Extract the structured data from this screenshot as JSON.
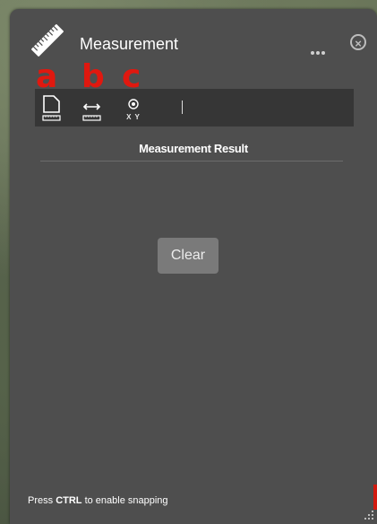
{
  "panel": {
    "title": "Measurement",
    "more_icon": "ellipsis-icon",
    "close_icon": "close-circle-icon",
    "header_icon": "ruler-icon"
  },
  "annotations": [
    "a",
    "b",
    "c"
  ],
  "toolbar": {
    "tools": [
      {
        "name": "area",
        "icon": "area-measure-icon"
      },
      {
        "name": "distance",
        "icon": "distance-measure-icon"
      },
      {
        "name": "location",
        "icon": "location-icon",
        "label": "X Y"
      }
    ]
  },
  "result": {
    "title": "Measurement Result",
    "clear_label": "Clear"
  },
  "footer": {
    "prefix": "Press ",
    "key": "CTRL",
    "suffix": " to enable snapping"
  },
  "colors": {
    "panel": "#4e4e4e",
    "toolbar": "#363636",
    "annotation": "#e0180f",
    "button": "#7a7a7a"
  }
}
